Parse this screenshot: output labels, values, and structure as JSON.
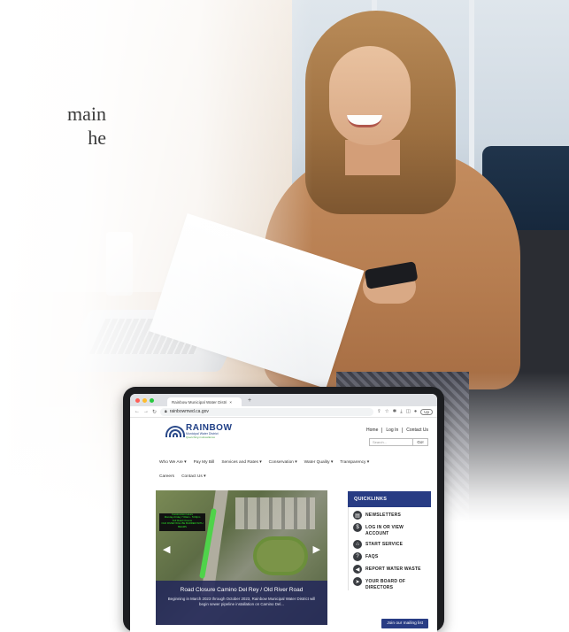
{
  "headline": {
    "line1": "main",
    "line2": "he"
  },
  "colors": {
    "brand_blue": "#283c84",
    "accent_green": "#3f9b3f",
    "route_green": "#4fd34a"
  },
  "browser": {
    "tab_title": "Rainbow Municipal Water Distri",
    "tab_close": "×",
    "new_tab": "+",
    "url": "rainbowmwd.ca.gov",
    "profile_label": "Up"
  },
  "site": {
    "logo_name": "RAINBOW",
    "logo_sub1": "Municipal Water District",
    "logo_sub2": "Quenching in Excellence",
    "top_links": [
      "Home",
      "Log In",
      "Contact Us"
    ],
    "search_placeholder": "Search...",
    "go_label": "Go!",
    "menu_row1": [
      "Who We Are ▾",
      "Pay My Bill",
      "Services and Rates ▾",
      "Conservation ▾",
      "Water Quality ▾",
      "Transparency ▾"
    ],
    "menu_row2": [
      "Careers",
      "Contact Us ▾"
    ]
  },
  "slider": {
    "sign_lines": [
      "Construction Hours",
      "Monday-Friday 7:00am - 5:00pm",
      "Full Road Closure",
      "OLD RIVER WILL BE BARRED WITH BEAMS"
    ],
    "title": "Road Closure Camino Del Rey / Old River Road",
    "body": "Beginning in March 2023 through October 2023, Rainbow Municipal Water District will begin sewer pipeline installation on Camino Del...",
    "prev_icon": "chevron-left-icon",
    "next_icon": "chevron-right-icon"
  },
  "quicklinks": {
    "heading": "QUICKLINKS",
    "items": [
      {
        "label": "NEWSLETTERS",
        "icon": "newsletter-icon",
        "glyph": "▤"
      },
      {
        "label": "LOG IN OR VIEW ACCOUNT",
        "icon": "dollar-icon",
        "glyph": "$"
      },
      {
        "label": "START SERVICE",
        "icon": "home-icon",
        "glyph": "⌂"
      },
      {
        "label": "FAQS",
        "icon": "question-icon",
        "glyph": "?"
      },
      {
        "label": "REPORT WATER WASTE",
        "icon": "megaphone-icon",
        "glyph": "◀"
      },
      {
        "label": "YOUR BOARD OF DIRECTORS",
        "icon": "arrow-icon",
        "glyph": "➤"
      }
    ],
    "mailing_label": "Join our mailing list"
  }
}
